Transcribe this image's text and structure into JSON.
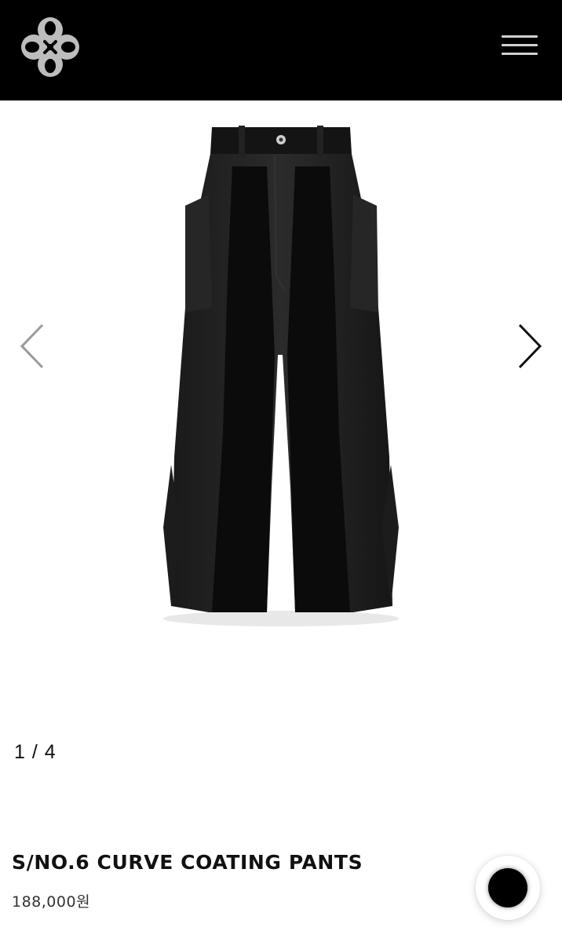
{
  "header": {
    "logo_icon": "brand-emblem-icon",
    "menu_icon": "hamburger-menu-icon",
    "background_color": "#000000"
  },
  "carousel": {
    "prev_icon": "chevron-left-icon",
    "next_icon": "chevron-right-icon",
    "counter": "1 / 4",
    "image": "black-curve-coating-pants"
  },
  "product": {
    "name": "S/NO.6 CURVE COATING PANTS",
    "price": "188,000원"
  },
  "floating_button": {
    "icon": "black-circle-icon"
  }
}
